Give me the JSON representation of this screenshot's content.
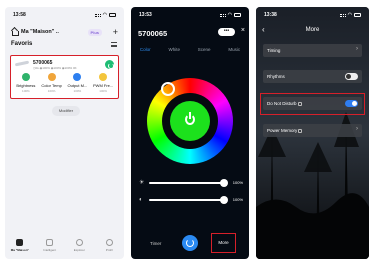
{
  "phone1": {
    "status": {
      "time": "13:58"
    },
    "home": {
      "name": "Ma \"Maison\" ..",
      "plus_badge": "Plus",
      "add": "+"
    },
    "favorites_title": "Favoris",
    "device": {
      "name": "5700065",
      "stats": "◷0s  ◉100%  ◉100%  ◉100%  0K",
      "features": [
        {
          "label": "Brightness",
          "value": "100%",
          "color": "#2fb36b"
        },
        {
          "label": "Color Temp",
          "value": "100%",
          "color": "#f0a53a"
        },
        {
          "label": "Output M...",
          "value": "100%",
          "color": "#2d7ff0"
        },
        {
          "label": "PWM Fre...",
          "value": "100%",
          "color": "#f3c53c"
        }
      ]
    },
    "modifier_label": "Modifier",
    "tabs": [
      {
        "label": "Ma \"Maison\"",
        "active": true
      },
      {
        "label": "Intelligent",
        "active": false
      },
      {
        "label": "Explorer",
        "active": false
      },
      {
        "label": "Profil",
        "active": false
      }
    ]
  },
  "phone2": {
    "status": {
      "time": "13:53"
    },
    "device_id": "5700065",
    "more_pill": "•••",
    "close": "×",
    "tabs": [
      "Color",
      "White",
      "Scene",
      "Music"
    ],
    "active_tab": "Color",
    "selected_color": "#1ce11c",
    "sliders": [
      {
        "icon": "☀",
        "value": "100%"
      },
      {
        "icon": "◐",
        "value": "100%"
      }
    ],
    "bottom": {
      "timer": "Timer",
      "more": "More"
    }
  },
  "phone3": {
    "status": {
      "time": "13:38"
    },
    "title": "More",
    "back": "‹",
    "rows": [
      {
        "label": "Timing",
        "control": "chevron"
      },
      {
        "label": "Rhythms",
        "control": "toggle",
        "on": false
      },
      {
        "label": "Do Not Disturb",
        "control": "toggle",
        "on": true
      },
      {
        "label": "Power Memory",
        "control": "chevron"
      }
    ]
  }
}
